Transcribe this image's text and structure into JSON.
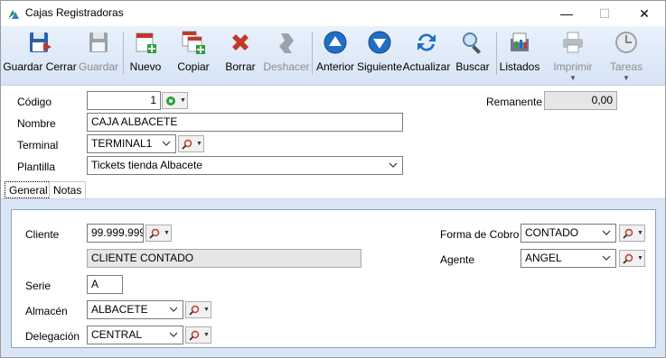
{
  "window": {
    "title": "Cajas Registradoras",
    "minimize_glyph": "—",
    "maximize_glyph": "☐",
    "close_glyph": "✕"
  },
  "toolbar": {
    "buttons": [
      {
        "label": "Guardar Cerrar",
        "icon": "save-close-icon",
        "enabled": true
      },
      {
        "label": "Guardar",
        "icon": "save-icon",
        "enabled": false
      },
      {
        "label": "Nuevo",
        "icon": "new-document-icon",
        "enabled": true
      },
      {
        "label": "Copiar",
        "icon": "copy-icon",
        "enabled": true
      },
      {
        "label": "Borrar",
        "icon": "delete-icon",
        "enabled": true
      },
      {
        "label": "Deshacer",
        "icon": "undo-icon",
        "enabled": false
      },
      {
        "label": "Anterior",
        "icon": "previous-icon",
        "enabled": true
      },
      {
        "label": "Siguiente",
        "icon": "next-icon",
        "enabled": true
      },
      {
        "label": "Actualizar",
        "icon": "refresh-icon",
        "enabled": true
      },
      {
        "label": "Buscar",
        "icon": "search-icon",
        "enabled": true
      },
      {
        "label": "Listados",
        "icon": "reports-icon",
        "enabled": true
      },
      {
        "label": "Imprimir",
        "icon": "printer-icon",
        "enabled": false
      },
      {
        "label": "Tareas",
        "icon": "tasks-clock-icon",
        "enabled": false
      }
    ]
  },
  "header_form": {
    "codigo_label": "Código",
    "codigo_value": "1",
    "nombre_label": "Nombre",
    "nombre_value": "CAJA ALBACETE",
    "terminal_label": "Terminal",
    "terminal_value": "TERMINAL1",
    "plantilla_label": "Plantilla",
    "plantilla_value": "Tickets tienda Albacete",
    "remanente_label": "Remanente",
    "remanente_value": "0,00"
  },
  "tabs": [
    {
      "label": "General",
      "active": true
    },
    {
      "label": "Notas",
      "active": false
    }
  ],
  "general": {
    "cliente_label": "Cliente",
    "cliente_code": "99.999.999",
    "cliente_name": "CLIENTE CONTADO",
    "serie_label": "Serie",
    "serie_value": "A",
    "almacen_label": "Almacén",
    "almacen_value": "ALBACETE",
    "delegacion_label": "Delegación",
    "delegacion_value": "CENTRAL",
    "forma_cobro_label": "Forma de Cobro",
    "forma_cobro_value": "CONTADO",
    "agente_label": "Agente",
    "agente_value": "ANGEL"
  },
  "colors": {
    "toolbar_top": "#e9f1fb",
    "toolbar_bottom": "#d6e4f5",
    "panel_bg": "#d9e6f5",
    "group_border": "#8aa2c6",
    "readonly_bg": "#e6e6e6"
  }
}
